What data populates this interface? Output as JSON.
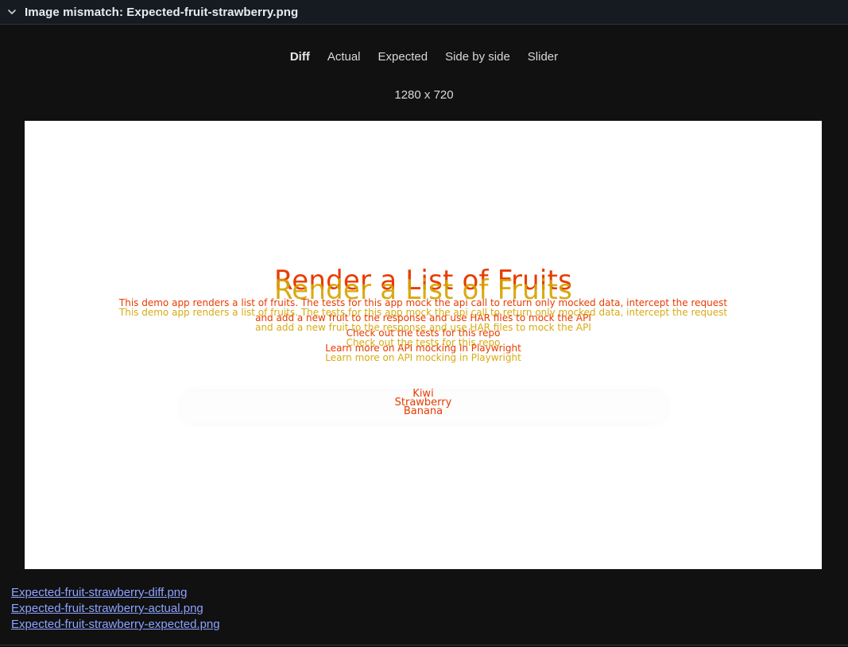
{
  "header": {
    "title": "Image mismatch: Expected-fruit-strawberry.png",
    "expand_icon": "chevron-down-icon"
  },
  "tabs": [
    {
      "label": "Diff",
      "active": true
    },
    {
      "label": "Actual",
      "active": false
    },
    {
      "label": "Expected",
      "active": false
    },
    {
      "label": "Side by side",
      "active": false
    },
    {
      "label": "Slider",
      "active": false
    }
  ],
  "image": {
    "dimensions": "1280 x 720",
    "content": {
      "title": "Render a List of Fruits",
      "para_line1": "This demo app renders a list of fruits. The tests for this app mock the api call to return only mocked data, intercept the request",
      "para_line2": "and add a new fruit to the response and use HAR files to mock the API",
      "link1": "Check out the tests for this repo",
      "link2": "Learn more on API mocking in Playwright",
      "fruits": [
        "Kiwi",
        "Strawberry",
        "Banana"
      ]
    },
    "colors": {
      "diff_primary": "#e83b00",
      "diff_secondary": "#d4a400"
    }
  },
  "attachments": [
    "Expected-fruit-strawberry-diff.png",
    "Expected-fruit-strawberry-actual.png",
    "Expected-fruit-strawberry-expected.png"
  ]
}
